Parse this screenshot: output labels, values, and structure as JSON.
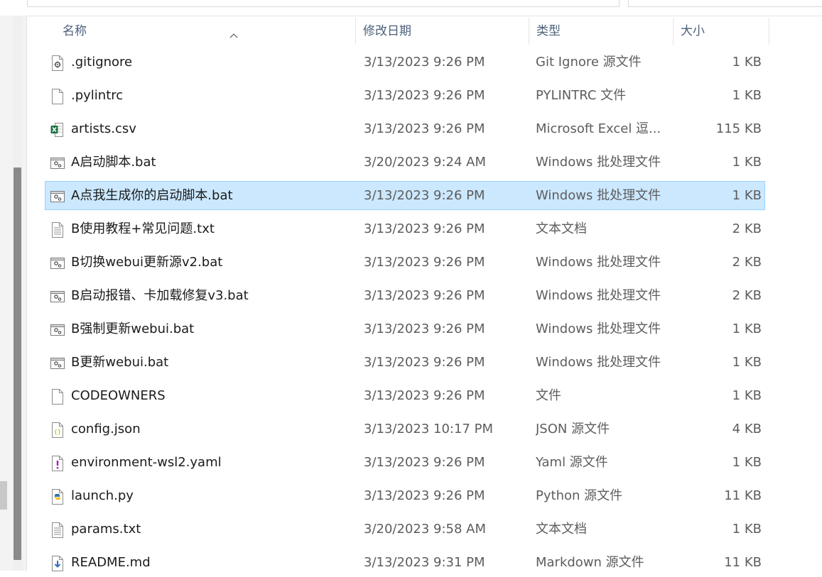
{
  "columns": {
    "name": "名称",
    "date": "修改日期",
    "type": "类型",
    "size": "大小"
  },
  "files": [
    {
      "name": ".gitignore",
      "date": "3/13/2023 9:26 PM",
      "type": "Git Ignore 源文件",
      "size": "1 KB",
      "icon": "gear-file-icon"
    },
    {
      "name": ".pylintrc",
      "date": "3/13/2023 9:26 PM",
      "type": "PYLINTRC 文件",
      "size": "1 KB",
      "icon": "blank-file-icon"
    },
    {
      "name": "artists.csv",
      "date": "3/13/2023 9:26 PM",
      "type": "Microsoft Excel 逗...",
      "size": "115 KB",
      "icon": "excel-file-icon"
    },
    {
      "name": "A启动脚本.bat",
      "date": "3/20/2023 9:24 AM",
      "type": "Windows 批处理文件",
      "size": "1 KB",
      "icon": "batch-file-icon"
    },
    {
      "name": "A点我生成你的启动脚本.bat",
      "date": "3/13/2023 9:26 PM",
      "type": "Windows 批处理文件",
      "size": "1 KB",
      "icon": "batch-file-icon",
      "selected": true
    },
    {
      "name": "B使用教程+常见问题.txt",
      "date": "3/13/2023 9:26 PM",
      "type": "文本文档",
      "size": "2 KB",
      "icon": "text-file-icon"
    },
    {
      "name": "B切换webui更新源v2.bat",
      "date": "3/13/2023 9:26 PM",
      "type": "Windows 批处理文件",
      "size": "2 KB",
      "icon": "batch-file-icon"
    },
    {
      "name": "B启动报错、卡加载修复v3.bat",
      "date": "3/13/2023 9:26 PM",
      "type": "Windows 批处理文件",
      "size": "2 KB",
      "icon": "batch-file-icon"
    },
    {
      "name": "B强制更新webui.bat",
      "date": "3/13/2023 9:26 PM",
      "type": "Windows 批处理文件",
      "size": "1 KB",
      "icon": "batch-file-icon"
    },
    {
      "name": "B更新webui.bat",
      "date": "3/13/2023 9:26 PM",
      "type": "Windows 批处理文件",
      "size": "1 KB",
      "icon": "batch-file-icon"
    },
    {
      "name": "CODEOWNERS",
      "date": "3/13/2023 9:26 PM",
      "type": "文件",
      "size": "1 KB",
      "icon": "blank-file-icon"
    },
    {
      "name": "config.json",
      "date": "3/13/2023 10:17 PM",
      "type": "JSON 源文件",
      "size": "4 KB",
      "icon": "json-file-icon"
    },
    {
      "name": "environment-wsl2.yaml",
      "date": "3/13/2023 9:26 PM",
      "type": "Yaml 源文件",
      "size": "1 KB",
      "icon": "yaml-file-icon"
    },
    {
      "name": "launch.py",
      "date": "3/13/2023 9:26 PM",
      "type": "Python 源文件",
      "size": "11 KB",
      "icon": "python-file-icon"
    },
    {
      "name": "params.txt",
      "date": "3/20/2023 9:58 AM",
      "type": "文本文档",
      "size": "1 KB",
      "icon": "text-file-icon"
    },
    {
      "name": "README.md",
      "date": "3/13/2023 9:31 PM",
      "type": "Markdown 源文件",
      "size": "11 KB",
      "icon": "markdown-file-icon"
    }
  ],
  "colors": {
    "selection_bg": "#cce8ff",
    "selection_border": "#99d1ff",
    "header_text": "#4c607a"
  }
}
